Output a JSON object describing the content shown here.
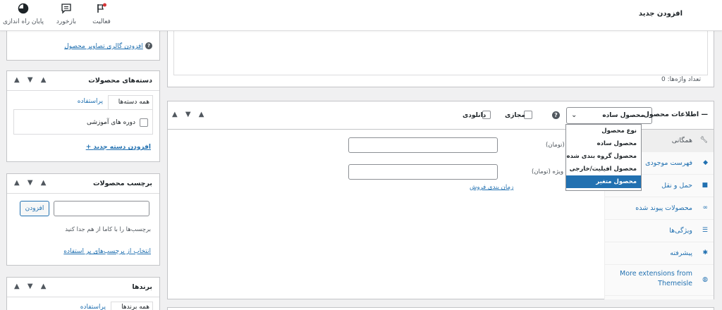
{
  "topbar": {
    "title": "افزودن جدید",
    "items": [
      {
        "label": "پایان راه اندازی",
        "icon": "progress-circle-icon"
      },
      {
        "label": "بازخورد",
        "icon": "feedback-icon"
      },
      {
        "label": "فعالیت",
        "icon": "activity-flag-icon"
      }
    ]
  },
  "description_box": {
    "word_count": "تعداد واژه‌ها: 0"
  },
  "product_data": {
    "title": "اطلاعات محصول —",
    "type_select_value": "محصول ساده",
    "virtual_label": "مجازی",
    "downloadable_label": "دانلودی",
    "tabs": [
      {
        "label": "همگانی",
        "icon": "wrench-icon",
        "active": true
      },
      {
        "label": "فهرست موجودی",
        "icon": "tag-icon",
        "active": false
      },
      {
        "label": "حمل و نقل",
        "icon": "truck-icon",
        "active": false
      },
      {
        "label": "محصولات پیوند شده",
        "icon": "link-icon",
        "active": false
      },
      {
        "label": "ویژگی‌ها",
        "icon": "list-icon",
        "active": false
      },
      {
        "label": "پیشرفته",
        "icon": "gear-icon",
        "active": false
      },
      {
        "label": "More extensions from Themeisle",
        "icon": "plugin-icon",
        "active": false
      }
    ],
    "regular_price_label": "(تومان)",
    "sale_price_label": "ویژه (تومان)",
    "schedule_link": "زمان بندی فروش",
    "type_dropdown": {
      "group_label": "نوع محصول",
      "options": [
        "محصول ساده",
        "محصول گروه بندی شده",
        "محصول افیلیت/خارجی",
        "محصول متغیر"
      ],
      "highlighted": "محصول متغیر"
    }
  },
  "gallery_box": {
    "link": "افزودن گالری تصاویر محصول"
  },
  "categories_box": {
    "title": "دسته‌های محصولات",
    "tab_all": "همه دسته‌ها",
    "tab_popular": "پراستفاده",
    "items": [
      {
        "label": "دوره های آموزشی",
        "checked": false
      }
    ],
    "add_link": "+ افزودن دسته جدید"
  },
  "tags_box": {
    "title": "برچسب محصولات",
    "add_button": "افزودن",
    "hint": "برچسب‌ها را با کاما از هم جدا کنید",
    "choose_link": "انتخاب از برچسب‌های پر استفاده"
  },
  "brands_box": {
    "title": "برندها",
    "tab_all": "همه برندها",
    "tab_popular": "پراستفاده"
  },
  "colors": {
    "accent": "#2271b1",
    "border": "#c3c4c7",
    "background": "#f0f0f1"
  }
}
